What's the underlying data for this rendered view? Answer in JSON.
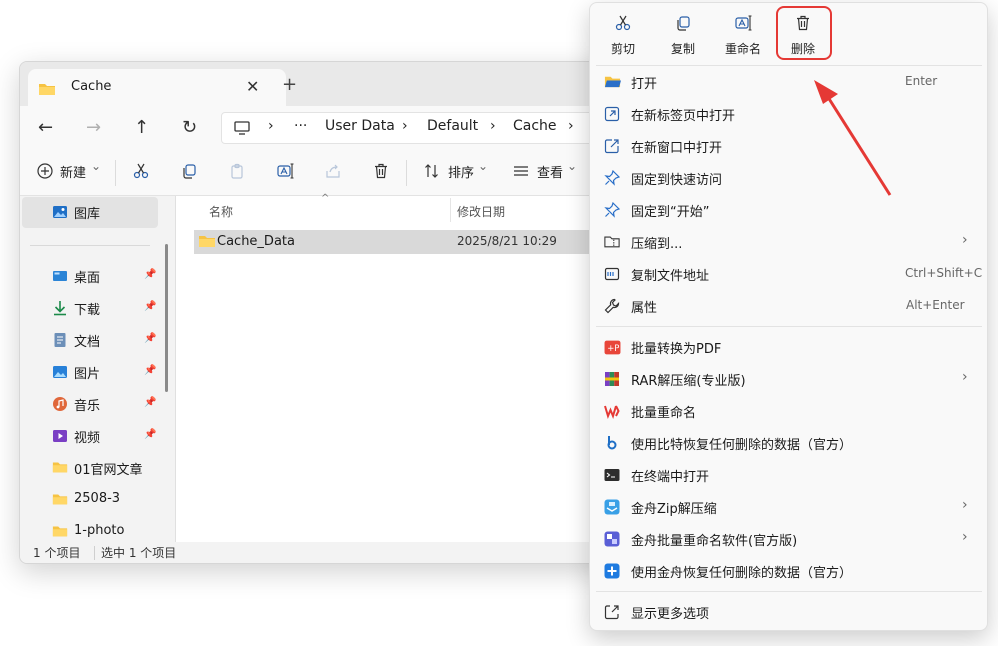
{
  "explorer": {
    "tab": {
      "title": "Cache",
      "close": "✕",
      "add": "+"
    },
    "nav": {
      "back": "←",
      "forward": "→",
      "up": "↑",
      "refresh": "↻"
    },
    "breadcrumb": {
      "more": "···",
      "items": [
        "User Data",
        "Default",
        "Cache"
      ],
      "sep": "›"
    },
    "toolbar": {
      "new_label": "新建",
      "sort_label": "排序",
      "view_label": "查看",
      "caret": "⌄"
    },
    "sidebar": {
      "items": [
        {
          "label": "图库",
          "icon": "gallery-icon"
        },
        {
          "label": "桌面",
          "icon": "desktop-icon"
        },
        {
          "label": "下载",
          "icon": "download-icon"
        },
        {
          "label": "文档",
          "icon": "documents-icon"
        },
        {
          "label": "图片",
          "icon": "pictures-icon"
        },
        {
          "label": "音乐",
          "icon": "music-icon"
        },
        {
          "label": "视频",
          "icon": "videos-icon"
        },
        {
          "label": "01官网文章",
          "icon": "folder-icon"
        },
        {
          "label": "2508-3",
          "icon": "folder-icon"
        },
        {
          "label": "1-photo",
          "icon": "folder-icon"
        }
      ]
    },
    "columns": {
      "name": "名称",
      "date": "修改日期"
    },
    "files": [
      {
        "name": "Cache_Data",
        "modified": "2025/8/21 10:29"
      }
    ],
    "status": {
      "count": "1 个项目",
      "selected": "选中 1 个项目"
    }
  },
  "context_menu": {
    "quick_actions": [
      {
        "label": "剪切",
        "icon": "scissors-icon"
      },
      {
        "label": "复制",
        "icon": "copy-icon"
      },
      {
        "label": "重命名",
        "icon": "rename-icon"
      },
      {
        "label": "删除",
        "icon": "trash-icon"
      }
    ],
    "items": [
      {
        "label": "打开",
        "shortcut": "Enter"
      },
      {
        "label": "在新标签页中打开"
      },
      {
        "label": "在新窗口中打开"
      },
      {
        "label": "固定到快速访问"
      },
      {
        "label": "固定到“开始”"
      },
      {
        "label": "压缩到...",
        "arrow": "›"
      },
      {
        "label": "复制文件地址",
        "shortcut": "Ctrl+Shift+C"
      },
      {
        "label": "属性",
        "shortcut": "Alt+Enter"
      },
      {
        "label": "批量转换为PDF"
      },
      {
        "label": "RAR解压缩(专业版)",
        "arrow": "›"
      },
      {
        "label": "批量重命名"
      },
      {
        "label": "使用比特恢复任何删除的数据（官方）"
      },
      {
        "label": "在终端中打开"
      },
      {
        "label": "金舟Zip解压缩",
        "arrow": "›"
      },
      {
        "label": "金舟批量重命名软件(官方版)",
        "arrow": "›"
      },
      {
        "label": "使用金舟恢复任何删除的数据（官方）"
      },
      {
        "label": "显示更多选项"
      }
    ]
  },
  "colors": {
    "accent": "#0067c0",
    "folder": "#f6c343",
    "highlight": "#e53935"
  }
}
